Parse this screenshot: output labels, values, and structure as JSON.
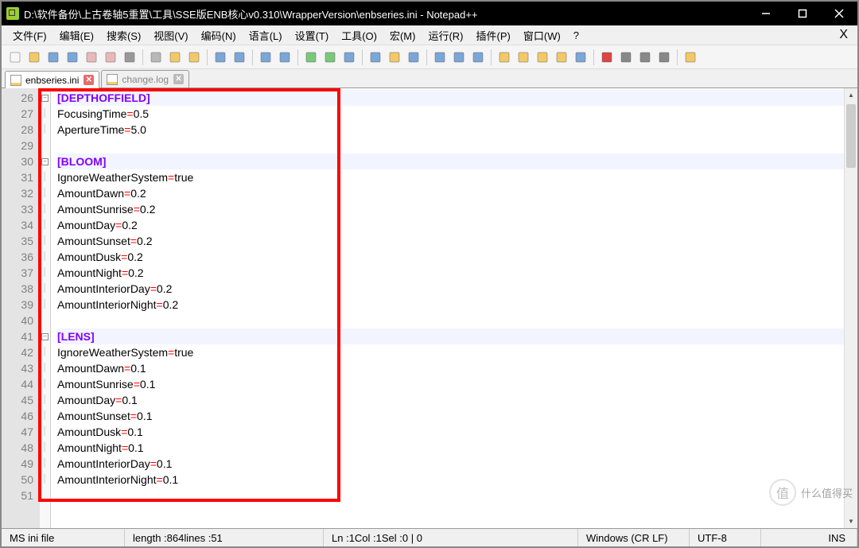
{
  "title": "D:\\软件备份\\上古卷轴5重置\\工具\\SSE版ENB核心v0.310\\WrapperVersion\\enbseries.ini - Notepad++",
  "menu": {
    "file": "文件(F)",
    "edit": "编辑(E)",
    "search": "搜索(S)",
    "view": "视图(V)",
    "encoding": "编码(N)",
    "language": "语言(L)",
    "settings": "设置(T)",
    "tools": "工具(O)",
    "macro": "宏(M)",
    "run": "运行(R)",
    "plugins": "插件(P)",
    "window": "窗口(W)",
    "help": "?",
    "close": "X"
  },
  "tabs": {
    "active": "enbseries.ini",
    "inactive": "change.log"
  },
  "lines": [
    {
      "n": 26,
      "type": "section",
      "fold": true,
      "text": "[DEPTHOFFIELD]",
      "hl": true
    },
    {
      "n": 27,
      "key": "FocusingTime",
      "val": "0.5"
    },
    {
      "n": 28,
      "key": "ApertureTime",
      "val": "5.0"
    },
    {
      "n": 29,
      "type": "blank"
    },
    {
      "n": 30,
      "type": "section",
      "fold": true,
      "text": "[BLOOM]",
      "hl": true
    },
    {
      "n": 31,
      "key": "IgnoreWeatherSystem",
      "val": "true"
    },
    {
      "n": 32,
      "key": "AmountDawn",
      "val": "0.2"
    },
    {
      "n": 33,
      "key": "AmountSunrise",
      "val": "0.2"
    },
    {
      "n": 34,
      "key": "AmountDay",
      "val": "0.2"
    },
    {
      "n": 35,
      "key": "AmountSunset",
      "val": "0.2"
    },
    {
      "n": 36,
      "key": "AmountDusk",
      "val": "0.2"
    },
    {
      "n": 37,
      "key": "AmountNight",
      "val": "0.2"
    },
    {
      "n": 38,
      "key": "AmountInteriorDay",
      "val": "0.2"
    },
    {
      "n": 39,
      "key": "AmountInteriorNight",
      "val": "0.2"
    },
    {
      "n": 40,
      "type": "blank"
    },
    {
      "n": 41,
      "type": "section",
      "fold": true,
      "text": "[LENS]",
      "hl": true
    },
    {
      "n": 42,
      "key": "IgnoreWeatherSystem",
      "val": "true"
    },
    {
      "n": 43,
      "key": "AmountDawn",
      "val": "0.1"
    },
    {
      "n": 44,
      "key": "AmountSunrise",
      "val": "0.1"
    },
    {
      "n": 45,
      "key": "AmountDay",
      "val": "0.1"
    },
    {
      "n": 46,
      "key": "AmountSunset",
      "val": "0.1"
    },
    {
      "n": 47,
      "key": "AmountDusk",
      "val": "0.1"
    },
    {
      "n": 48,
      "key": "AmountNight",
      "val": "0.1"
    },
    {
      "n": 49,
      "key": "AmountInteriorDay",
      "val": "0.1"
    },
    {
      "n": 50,
      "key": "AmountInteriorNight",
      "val": "0.1"
    },
    {
      "n": 51,
      "type": "blank"
    }
  ],
  "status": {
    "filetype": "MS ini file",
    "length_label": "length : ",
    "length": "864",
    "lines_label": "   lines : ",
    "lines": "51",
    "ln_label": "Ln : ",
    "ln": "1",
    "col_label": "   Col : ",
    "col": "1",
    "sel_label": "   Sel : ",
    "sel": "0 | 0",
    "eol": "Windows (CR LF)",
    "enc": "UTF-8",
    "mode": "INS"
  },
  "watermark": "什么值得买",
  "toolbar_icons": [
    "new-file",
    "open-file",
    "save",
    "save-all",
    "close",
    "close-all",
    "print",
    "|",
    "cut",
    "copy",
    "paste",
    "|",
    "undo",
    "redo",
    "|",
    "find",
    "replace",
    "|",
    "zoom-in",
    "zoom-out",
    "sync",
    "|",
    "wrap",
    "show-all",
    "indent-guide",
    "|",
    "lang",
    "fold",
    "unfold",
    "|",
    "hide",
    "doc-map",
    "func-list",
    "folder",
    "eye",
    "|",
    "record",
    "stop",
    "play",
    "play-multi",
    "|",
    "macro-save"
  ],
  "icon_colors": {
    "new-file": "#f7f7f7",
    "open-file": "#f2c968",
    "save": "#7aa6d8",
    "save-all": "#7aa6d8",
    "close": "#e8b8b8",
    "close-all": "#e8b8b8",
    "print": "#999",
    "cut": "#b8b8b8",
    "copy": "#f2c968",
    "paste": "#f2c968",
    "undo": "#7aa6d8",
    "redo": "#7aa6d8",
    "find": "#7aa6d8",
    "replace": "#7aa6d8",
    "zoom-in": "#7ac87a",
    "zoom-out": "#7ac87a",
    "sync": "#7aa6d8",
    "wrap": "#7aa6d8",
    "show-all": "#f2c968",
    "indent-guide": "#7aa6d8",
    "lang": "#7aa6d8",
    "fold": "#7aa6d8",
    "unfold": "#7aa6d8",
    "hide": "#f2c968",
    "doc-map": "#f2c968",
    "func-list": "#f2c968",
    "folder": "#f2c968",
    "eye": "#7aa6d8",
    "record": "#d44",
    "stop": "#888",
    "play": "#888",
    "play-multi": "#888",
    "macro-save": "#f2c968"
  }
}
